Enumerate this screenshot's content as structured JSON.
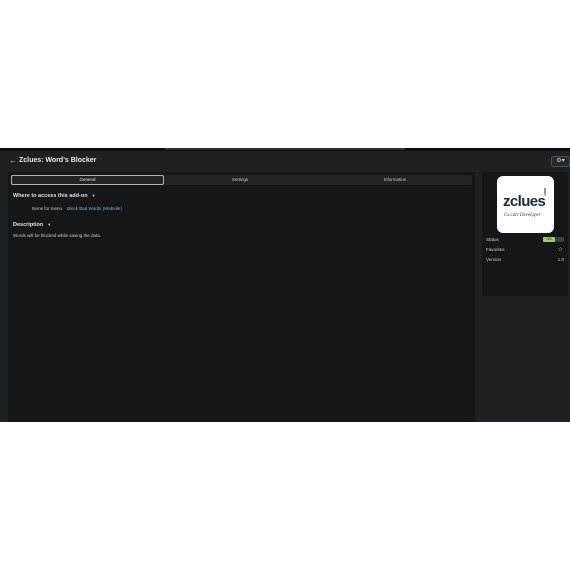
{
  "header": {
    "back_icon": "back-arrow-icon",
    "title": "Zclues: Word's Blocker",
    "settings_icon": "gear-icon",
    "settings_caret": "▾"
  },
  "tabs": [
    {
      "label": "General",
      "active": true
    },
    {
      "label": "Settings",
      "active": false
    },
    {
      "label": "Information",
      "active": false
    }
  ],
  "access_section": {
    "heading": "Where to access this add-on",
    "items_label": "Items for menu",
    "items_link": "Block Bad Words (Website)"
  },
  "description_section": {
    "heading": "Description",
    "text": "Words will be blocked while saving the data."
  },
  "sidebar": {
    "logo": {
      "brand": "zclues",
      "domain": ".com",
      "tagline": "Cs.cart Developer"
    },
    "status_label": "Status",
    "status_toggle": "ON",
    "favorites_label": "Favorites",
    "favorites_icon": "star-icon",
    "version_label": "Version",
    "version_value": "1.0"
  },
  "colors": {
    "background": "#1e2124",
    "panel": "#141618",
    "link": "#7fb3e6",
    "toggle_on": "#9ccc65"
  }
}
